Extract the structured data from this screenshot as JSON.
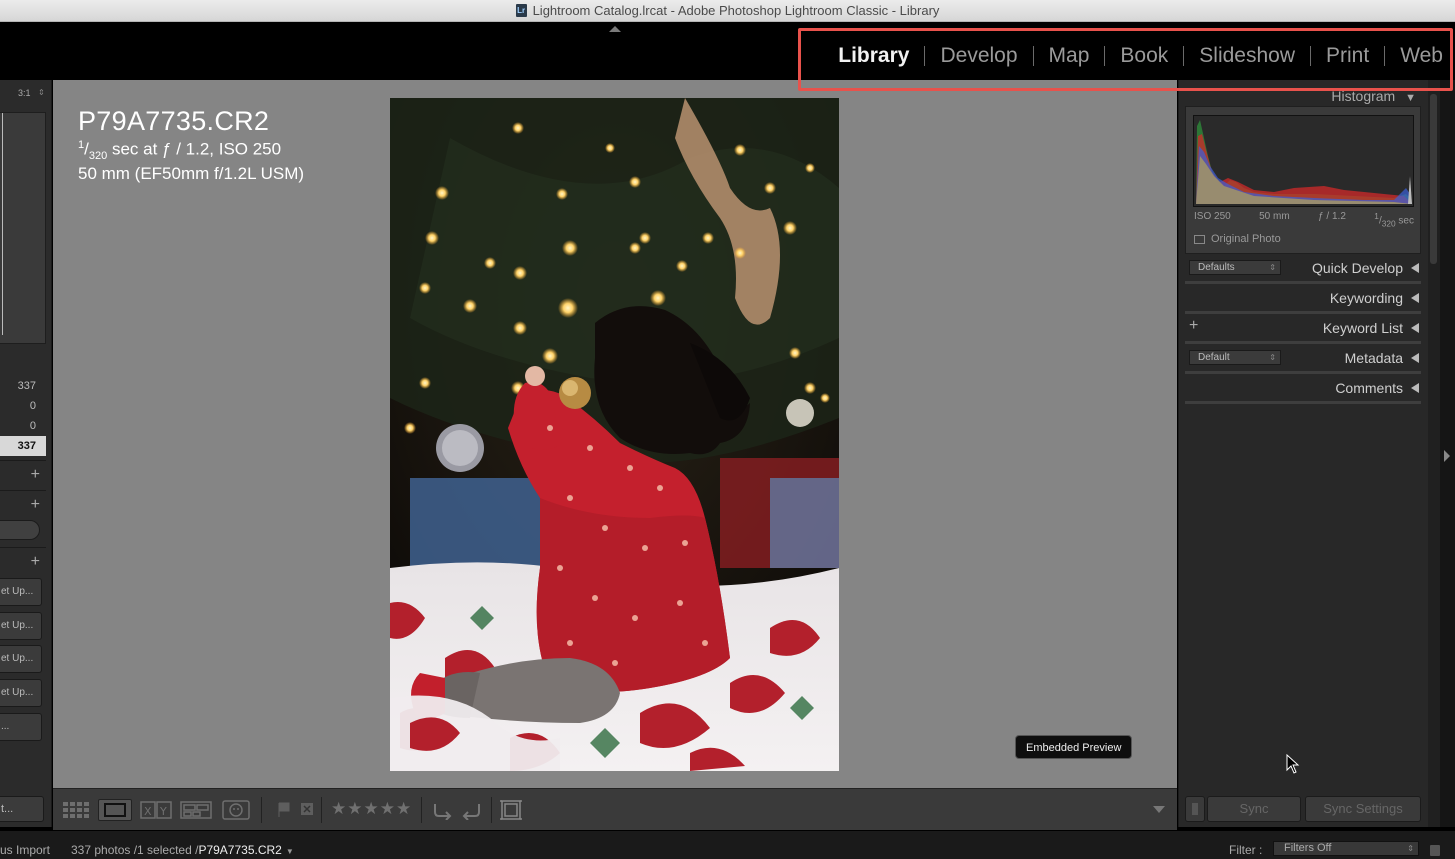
{
  "window": {
    "title": "Lightroom Catalog.lrcat - Adobe Photoshop Lightroom Classic - Library",
    "icon_letter": "Lr"
  },
  "modules": [
    {
      "label": "Library",
      "active": true
    },
    {
      "label": "Develop",
      "active": false
    },
    {
      "label": "Map",
      "active": false
    },
    {
      "label": "Book",
      "active": false
    },
    {
      "label": "Slideshow",
      "active": false
    },
    {
      "label": "Print",
      "active": false
    },
    {
      "label": "Web",
      "active": false
    }
  ],
  "left_panel": {
    "zoom": "3:1",
    "counts": [
      "337",
      "0",
      "0",
      "337"
    ],
    "preset_buttons": [
      "et Up...",
      "et Up...",
      "et Up...",
      "et Up...",
      "..."
    ],
    "import_label": "t..."
  },
  "photo_info": {
    "filename": "P79A7735.CR2",
    "exposure_prefix": "1",
    "exposure_denominator": "320",
    "exposure_suffix": " sec at ƒ / 1.2, ISO 250",
    "lens": "50 mm (EF50mm f/1.2L USM)"
  },
  "preview_badge": "Embedded Preview",
  "right_panel": {
    "histogram_title": "Histogram",
    "histogram_info": {
      "iso": "ISO 250",
      "focal": "50 mm",
      "aperture": "ƒ / 1.2",
      "shutter_num": "1",
      "shutter_den": "320",
      "shutter_unit": " sec"
    },
    "original_photo": "Original Photo",
    "quick_develop": {
      "label": "Quick Develop",
      "preset": "Defaults"
    },
    "keywording": "Keywording",
    "keyword_list": "Keyword List",
    "metadata": {
      "label": "Metadata",
      "preset": "Default"
    },
    "comments": "Comments",
    "sync": "Sync",
    "sync_settings": "Sync Settings"
  },
  "toolbar": {
    "stars": "★★★★★"
  },
  "status_bar": {
    "import": "us Import",
    "count": "337 photos /1 selected /",
    "selected_file": "P79A7735.CR2",
    "filter_label": "Filter :",
    "filter_value": "Filters Off"
  },
  "colors": {
    "highlight": "#e8524c",
    "background": "#858585",
    "panel": "#282828"
  }
}
